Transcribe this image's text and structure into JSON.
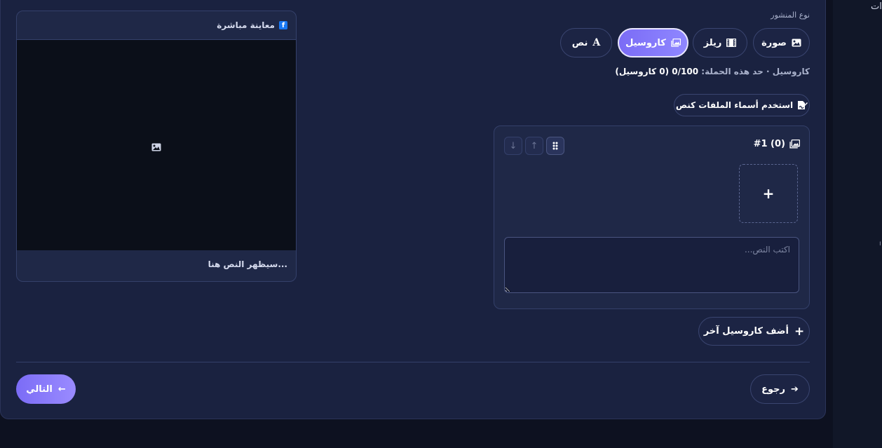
{
  "sidebar_fragment": {
    "text": "ات",
    "dot": "ı"
  },
  "preview": {
    "title": "معاينة مباشرة",
    "platform_icon": "facebook-icon",
    "media_icon": "image-icon",
    "caption_placeholder": "سيظهر النص هنا..."
  },
  "post_type": {
    "label": "نوع المنشور",
    "options": [
      {
        "label": "صورة",
        "icon": "image-icon",
        "active": false
      },
      {
        "label": "ريلز",
        "icon": "film-icon",
        "active": false
      },
      {
        "label": "كاروسيل",
        "icon": "images-icon",
        "active": true
      },
      {
        "label": "نص",
        "icon": "text-icon",
        "glyph": "A",
        "active": false
      }
    ]
  },
  "campaign_limit": {
    "prefix": "كاروسيل · حد هذه الحملة:",
    "value": "0/100 (0 كاروسيل)"
  },
  "filename_button": {
    "label": "استخدم أسماء الملفات كنص",
    "icon": "file-signature-icon"
  },
  "carousel": {
    "title": "#1 (0)",
    "icon": "images-icon",
    "add_symbol": "+",
    "textarea_placeholder": "اكتب النص...",
    "textarea_value": ""
  },
  "add_carousel_button": {
    "label": "أضف كاروسيل آخر",
    "symbol": "+"
  },
  "navigation": {
    "back_label": "رجوع",
    "next_label": "التالي"
  },
  "colors": {
    "accent": "#7b6cf6",
    "background": "#0d1120",
    "card": "#1a2240"
  }
}
